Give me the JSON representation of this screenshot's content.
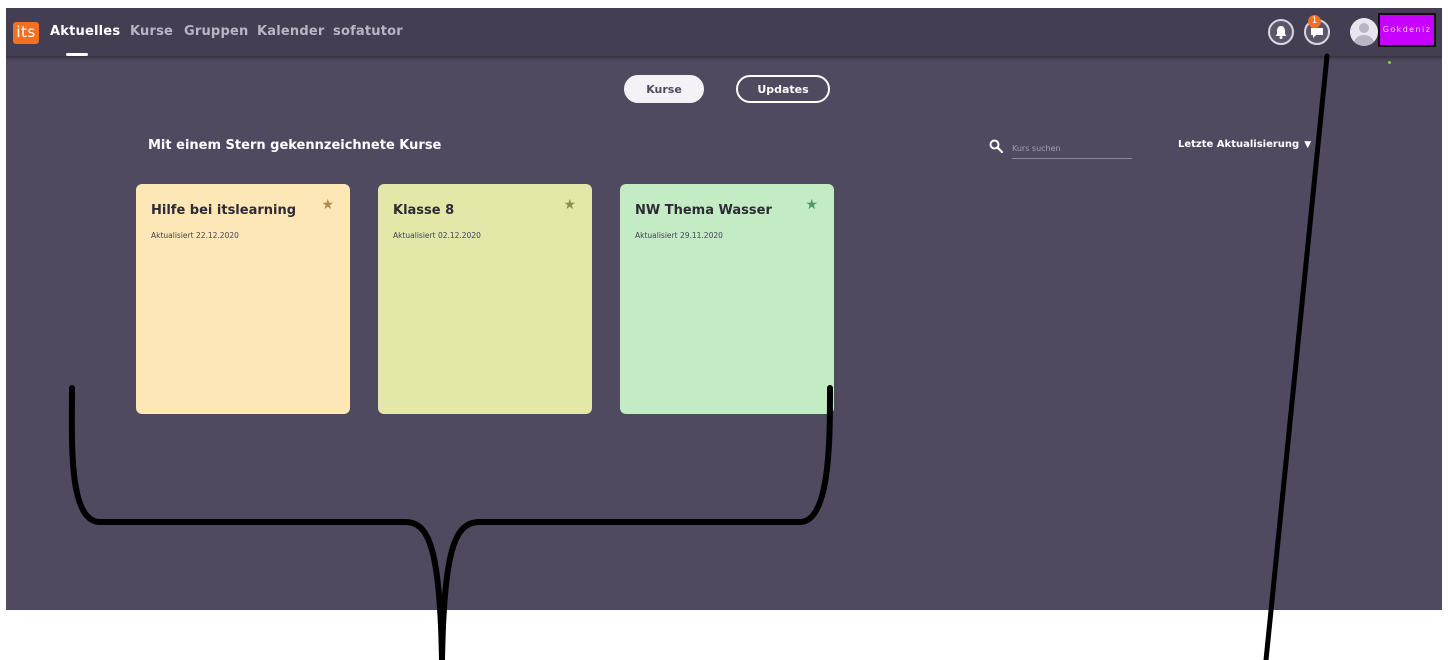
{
  "app": {
    "logo": "its",
    "nav": [
      {
        "label": "Aktuelles",
        "active": true
      },
      {
        "label": "Kurse",
        "active": false
      },
      {
        "label": "Gruppen",
        "active": false
      },
      {
        "label": "Kalender",
        "active": false
      },
      {
        "label": "sofatutor",
        "active": false
      }
    ],
    "icons": {
      "notifications": "bell-icon",
      "messages": "chat-icon",
      "avatar": "user-avatar-icon"
    },
    "message_badge": "1",
    "user_name": "Gokdeniz"
  },
  "toggle": {
    "kurse_label": "Kurse",
    "updates_label": "Updates",
    "selected": "Kurse"
  },
  "section": {
    "title": "Mit einem Stern gekennzeichnete Kurse",
    "search_placeholder": "Kurs suchen",
    "sort_label": "Letzte Aktualisierung"
  },
  "cards": [
    {
      "title": "Hilfe bei itslearning",
      "updated": "Aktualisiert 22.12.2020",
      "color": "#fde7b6",
      "star_color": "#b08a52"
    },
    {
      "title": "Klasse 8",
      "updated": "Aktualisiert 02.12.2020",
      "color": "#e3e8a9",
      "star_color": "#8a8f4a"
    },
    {
      "title": "NW Thema Wasser",
      "updated": "Aktualisiert 29.11.2020",
      "color": "#c3ecc5",
      "star_color": "#4e9a62"
    }
  ],
  "colors": {
    "background": "#4f4a5f",
    "topbar": "#433e52",
    "accent": "#f37021",
    "highlight": "#c800ff"
  }
}
